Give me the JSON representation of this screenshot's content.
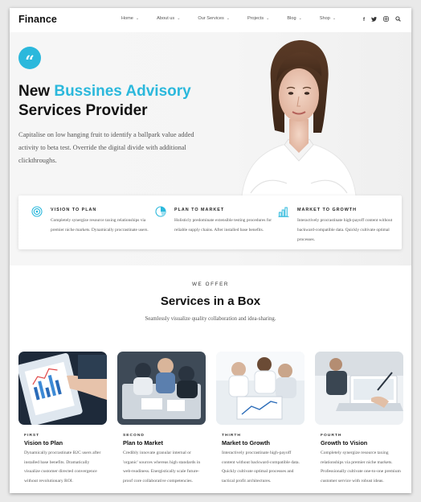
{
  "header": {
    "logo": "Finance",
    "nav": [
      {
        "label": "Home"
      },
      {
        "label": "About us"
      },
      {
        "label": "Our Services"
      },
      {
        "label": "Projects"
      },
      {
        "label": "Blog"
      },
      {
        "label": "Shop"
      }
    ],
    "social": [
      "f",
      "t",
      "ig",
      "search"
    ]
  },
  "hero": {
    "title_line1_plain": "New ",
    "title_line1_accent": "Bussines Advisory",
    "title_line2": "Services Provider",
    "text": "Capitalise on low hanging fruit to identify a ballpark value added activity to beta test. Override the digital divide with additional clickthroughs.",
    "accent_color": "#2bb8dc"
  },
  "features": [
    {
      "icon": "target-icon",
      "title": "VISION TO PLAN",
      "text": "Completely synergize resource taxing relationships via premier niche markets. Dynamically procrastinate users."
    },
    {
      "icon": "pie-chart-icon",
      "title": "PLAN TO MARKET",
      "text": "Holisticly predominate extensible testing procedures for reliable supply chains. After installed base benefits."
    },
    {
      "icon": "bar-chart-icon",
      "title": "MARKET TO GROWTH",
      "text": "Interactively procrastinate high-payoff content without backward-compatible data. Quickly cultivate optimal processes."
    }
  ],
  "offer": {
    "kicker": "WE OFFER",
    "title": "Services in a Box",
    "subtitle": "Seamlessly visualize quality collaboration and idea-sharing."
  },
  "services": [
    {
      "kicker": "FIRST",
      "title": "Vision to Plan",
      "text": "Dynamically procrastinate B2C users after installed base benefits. Dramatically visualize customer directed convergence without revolutionary ROI."
    },
    {
      "kicker": "SECOND",
      "title": "Plan to Market",
      "text": "Credibly innovate granular internal or 'organic' sources whereas high standards in web-readiness. Energistically scale future-proof core collaborative competencies."
    },
    {
      "kicker": "THIRTH",
      "title": "Market to Growth",
      "text": "Interactively procrastinate high-payoff content without backward-compatible data. Quickly cultivate optimal processes and tactical profit architectures."
    },
    {
      "kicker": "FOURTH",
      "title": "Growth to Vision",
      "text": "Completely synergize resource taxing relationships via premier niche markets. Professionally cultivate one-to-one premium customer service with robust ideas."
    }
  ]
}
